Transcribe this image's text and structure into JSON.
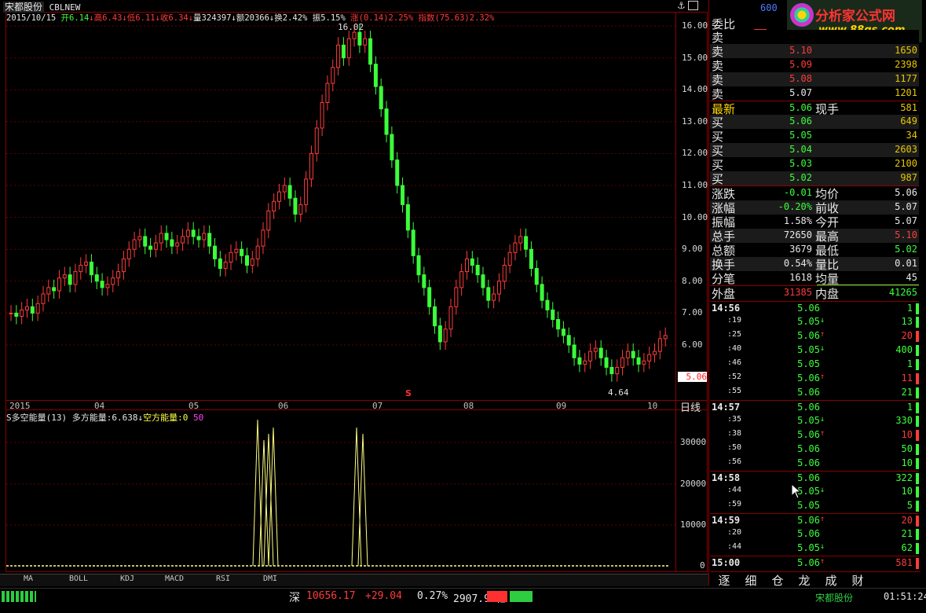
{
  "header": {
    "stock_name": "宋都股份",
    "formula": "CBLNEW",
    "date": "2015/10/15",
    "open_label": "开",
    "open": "6.14",
    "high_label": "高",
    "high": "6.43",
    "low_label": "低",
    "low": "6.11",
    "close_label": "收",
    "close": "6.34",
    "volume_label": "量",
    "volume": "324397",
    "amount_label": "额",
    "amount": "20366",
    "turnover_label": "换",
    "turnover": "2.42%",
    "amplitude_label": "振",
    "amplitude": "5.15%",
    "change_label": "涨",
    "change": "(0.14)2.25%",
    "index_label": "指数",
    "index": "(75.63)2.32%",
    "code_partial": "600",
    "name_faded": "宋都股份"
  },
  "logo": {
    "title": "分析家公式网",
    "url": "www.88gs.com"
  },
  "price_axis": [
    "16.00",
    "15.00",
    "14.00",
    "13.00",
    "12.00",
    "11.00",
    "10.00",
    "9.00",
    "8.00",
    "7.00",
    "6.00"
  ],
  "current_price_tag": "5.06",
  "max_label": "16.02",
  "min_label": "4.64",
  "months": [
    "2015",
    "04",
    "05",
    "06",
    "07",
    "08",
    "09",
    "10"
  ],
  "period_label": "日线",
  "s_marker": "S",
  "indicator": {
    "title": "S多空能量(13)",
    "long_label": "多方能量:",
    "long_value": "6.638",
    "short_label": "空方能量:",
    "short_value": "0",
    "extra": "50",
    "axis": [
      "30000",
      "20000",
      "10000",
      "0"
    ]
  },
  "tabs": [
    "MA",
    "BOLL",
    "KDJ",
    "MACD",
    "RSI",
    "DMI"
  ],
  "order_book": {
    "ratio_label": "委比",
    "sells": [
      {
        "label": "卖",
        "price": "",
        "vol": ""
      },
      {
        "label": "卖",
        "price": "5.10",
        "vol": "1650"
      },
      {
        "label": "卖",
        "price": "5.09",
        "vol": "2398"
      },
      {
        "label": "卖",
        "price": "5.08",
        "vol": "1177"
      },
      {
        "label": "卖",
        "price": "5.07",
        "vol": "1201"
      }
    ],
    "latest_label": "最新",
    "latest": "5.06",
    "current_hand_label": "现手",
    "current_hand": "581",
    "buys": [
      {
        "label": "买",
        "price": "5.06",
        "vol": "649"
      },
      {
        "label": "买",
        "price": "5.05",
        "vol": "34"
      },
      {
        "label": "买",
        "price": "5.04",
        "vol": "2603"
      },
      {
        "label": "买",
        "price": "5.03",
        "vol": "2100"
      },
      {
        "label": "买",
        "price": "5.02",
        "vol": "987"
      }
    ]
  },
  "stats": [
    {
      "l1": "涨跌",
      "v1": "-0.01",
      "l2": "均价",
      "v2": "5.06"
    },
    {
      "l1": "涨幅",
      "v1": "-0.20%",
      "l2": "前收",
      "v2": "5.07"
    },
    {
      "l1": "振幅",
      "v1": "1.58%",
      "l2": "今开",
      "v2": "5.07"
    },
    {
      "l1": "总手",
      "v1": "72650",
      "l2": "最高",
      "v2": "5.10"
    },
    {
      "l1": "总额",
      "v1": "3679",
      "l2": "最低",
      "v2": "5.02"
    },
    {
      "l1": "换手",
      "v1": "0.54%",
      "l2": "量比",
      "v2": "0.01"
    },
    {
      "l1": "分笔",
      "v1": "1618",
      "l2": "均量",
      "v2": "45"
    }
  ],
  "outer": {
    "l1": "外盘",
    "v1": "31385",
    "l2": "内盘",
    "v2": "41265"
  },
  "ticks": [
    {
      "time": "14:56",
      "price": "5.06",
      "arrow": "",
      "vol": "1"
    },
    {
      "time": ":19",
      "price": "5.05",
      "arrow": "↓",
      "vol": "13"
    },
    {
      "time": ":25",
      "price": "5.06",
      "arrow": "↑",
      "vol": "20"
    },
    {
      "time": ":40",
      "price": "5.05",
      "arrow": "↓",
      "vol": "400"
    },
    {
      "time": ":46",
      "price": "5.05",
      "arrow": "",
      "vol": "1"
    },
    {
      "time": ":52",
      "price": "5.06",
      "arrow": "↑",
      "vol": "11"
    },
    {
      "time": ":55",
      "price": "5.06",
      "arrow": "",
      "vol": "21"
    },
    {
      "time": "14:57",
      "price": "5.06",
      "arrow": "",
      "vol": "1"
    },
    {
      "time": ":35",
      "price": "5.05",
      "arrow": "↓",
      "vol": "330"
    },
    {
      "time": ":38",
      "price": "5.06",
      "arrow": "↑",
      "vol": "10"
    },
    {
      "time": ":50",
      "price": "5.06",
      "arrow": "",
      "vol": "50"
    },
    {
      "time": ":56",
      "price": "5.06",
      "arrow": "",
      "vol": "10"
    },
    {
      "time": "14:58",
      "price": "5.06",
      "arrow": "",
      "vol": "322"
    },
    {
      "time": ":44",
      "price": "5.05",
      "arrow": "↓",
      "vol": "10"
    },
    {
      "time": ":59",
      "price": "5.05",
      "arrow": "",
      "vol": "5"
    },
    {
      "time": "14:59",
      "price": "5.06",
      "arrow": "↑",
      "vol": "20"
    },
    {
      "time": ":20",
      "price": "5.06",
      "arrow": "",
      "vol": "21"
    },
    {
      "time": ":44",
      "price": "5.05",
      "arrow": "↓",
      "vol": "62"
    },
    {
      "time": "15:00",
      "price": "5.06",
      "arrow": "↑",
      "vol": "581"
    }
  ],
  "side_tabs": [
    "逐",
    "细",
    "仓",
    "龙",
    "成",
    "财"
  ],
  "status_bar": {
    "market": "深",
    "index": "10656.17",
    "change": "+29.04",
    "pct": "0.27%",
    "amount": "2907.91亿",
    "stock": "宋都股份",
    "clock": "01:51:24"
  },
  "colors": {
    "up": "#ff3b3b",
    "down": "#3bff3b",
    "grid": "#8a0000",
    "indicator": "#ffff80"
  }
}
